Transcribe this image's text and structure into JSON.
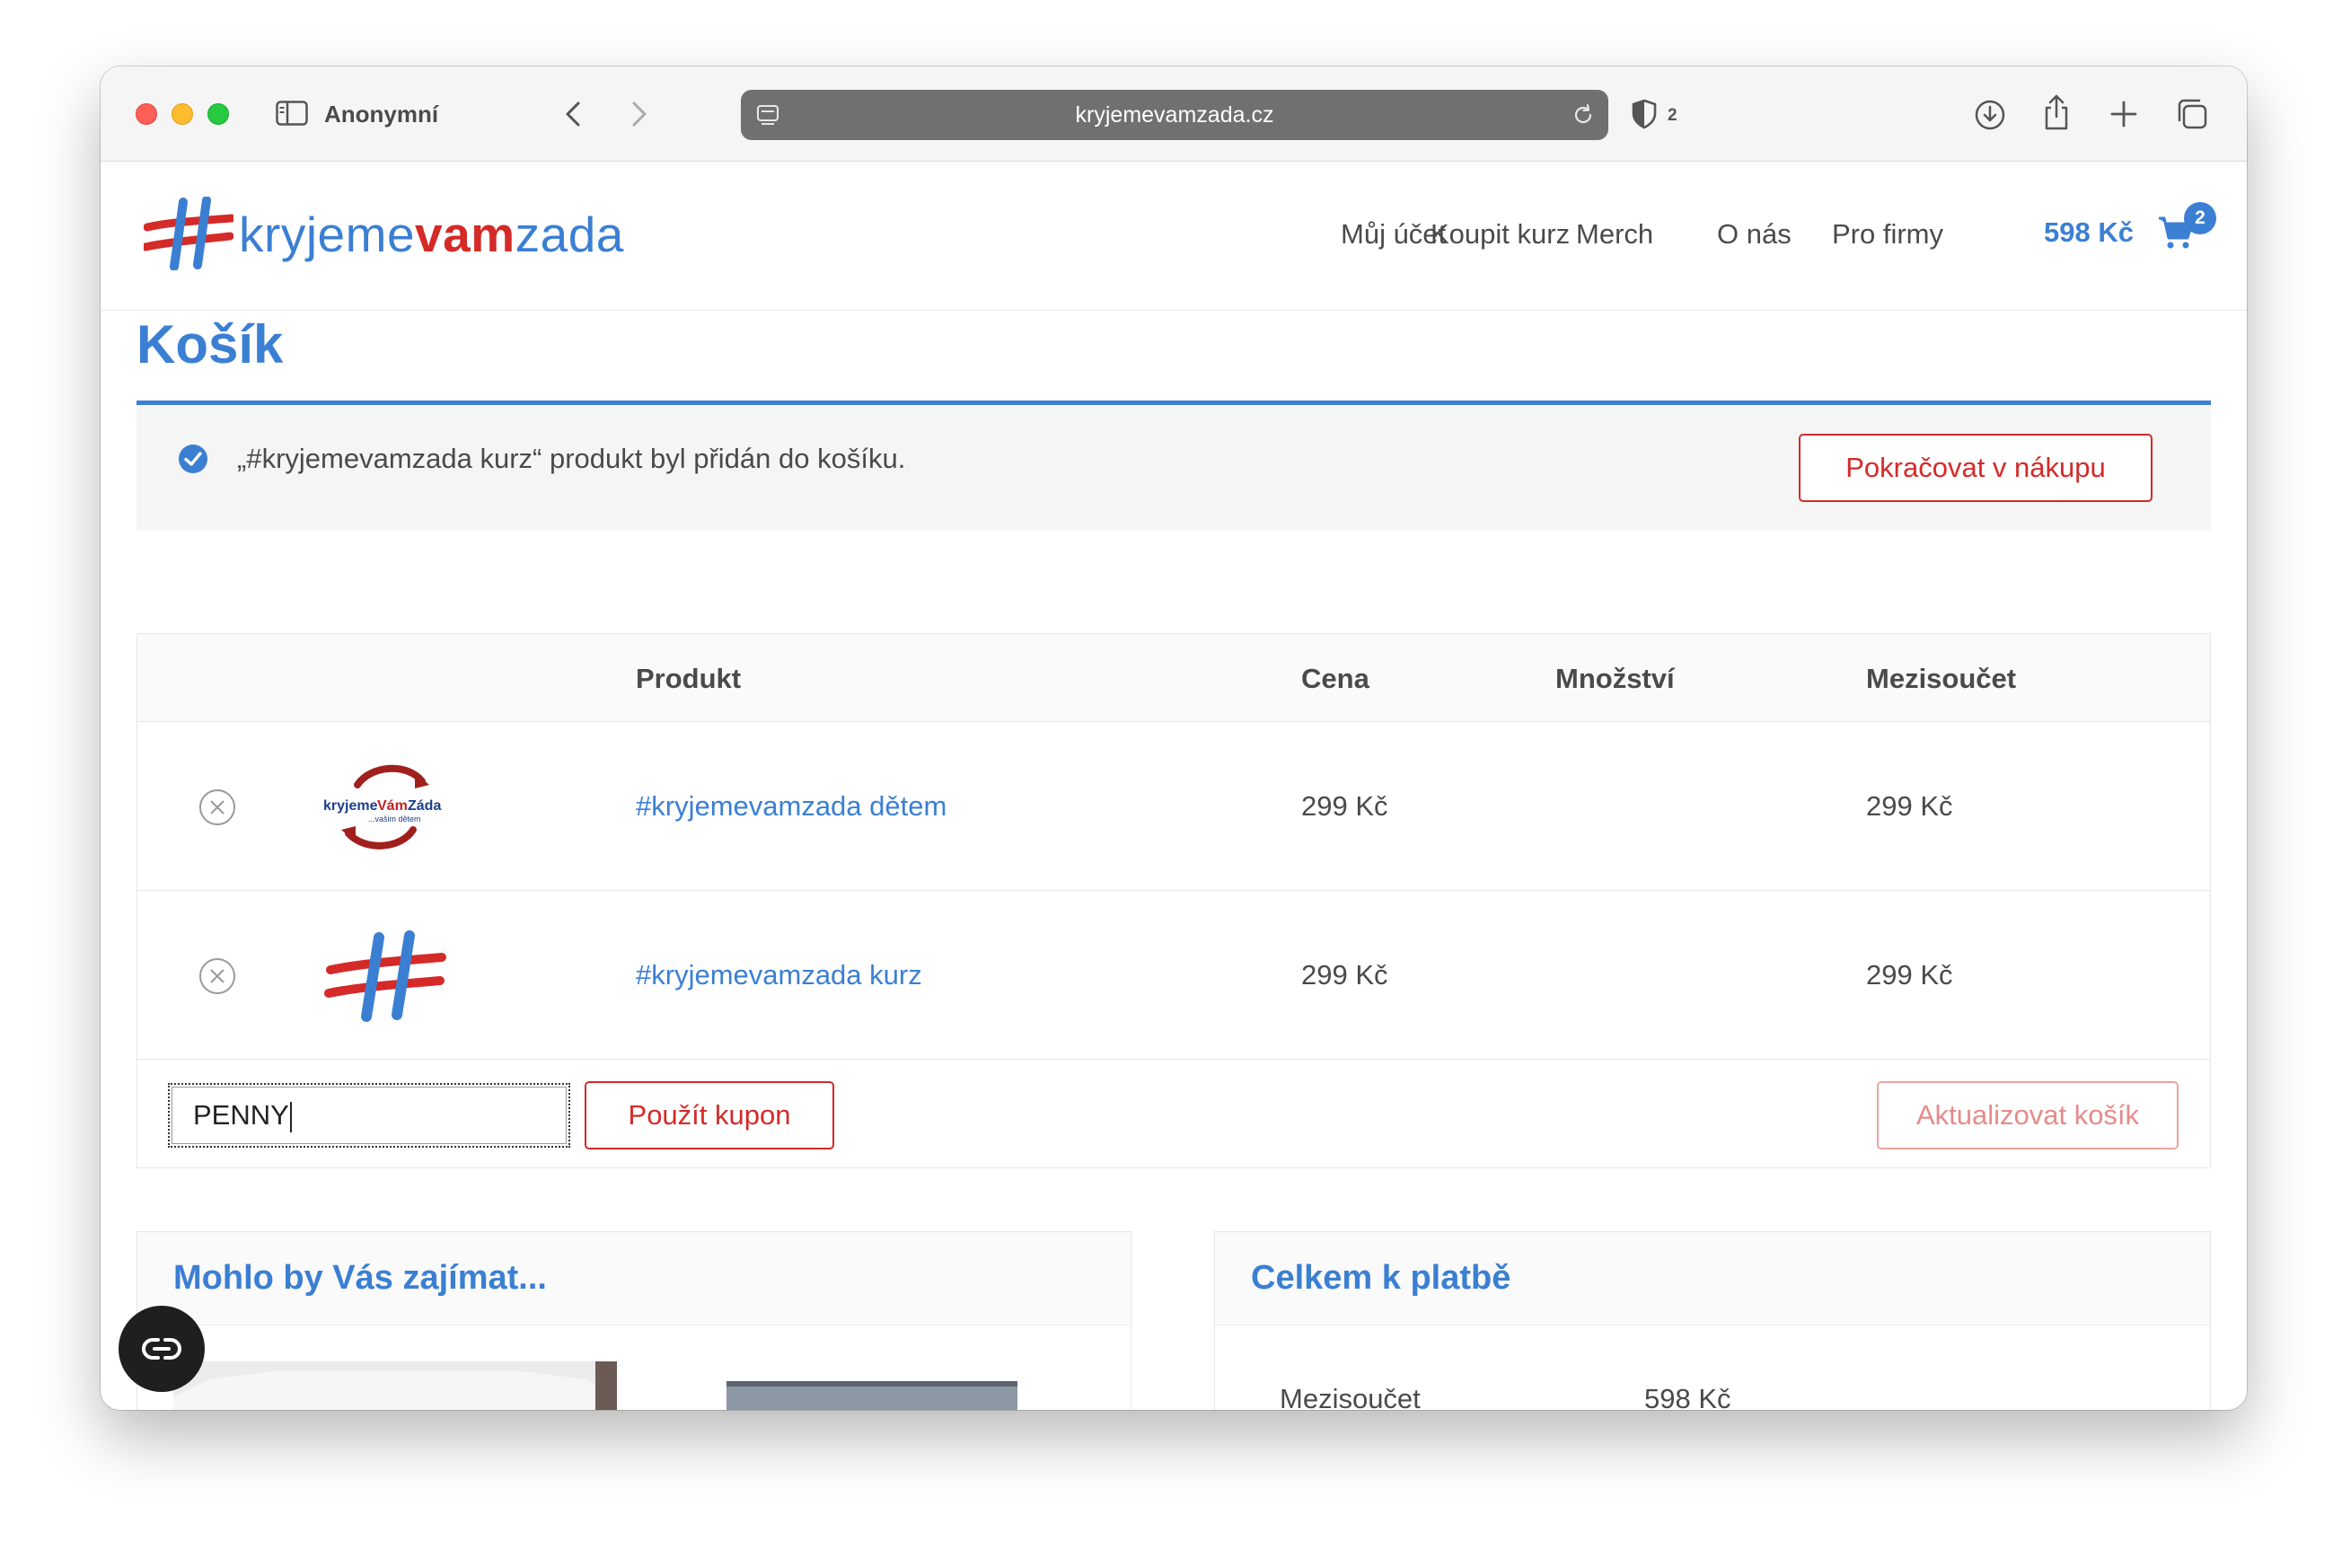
{
  "browser": {
    "profile_label": "Anonymní",
    "url": "kryjemevamzada.cz",
    "shield_count": "2"
  },
  "site": {
    "logo_part1": "kryjeme",
    "logo_part2": "vam",
    "logo_part3": "zada",
    "nav": [
      "Můj účet",
      "Koupit kurz",
      "Merch",
      "O nás",
      "Pro firmy"
    ],
    "cart_total": "598 Kč",
    "cart_count": "2"
  },
  "page": {
    "title": "Košík"
  },
  "notice": {
    "message": "„#kryjemevamzada kurz“ produkt byl přidán do košíku.",
    "button": "Pokračovat v nákupu"
  },
  "cart": {
    "headers": {
      "product": "Produkt",
      "price": "Cena",
      "quantity": "Množství",
      "subtotal": "Mezisoučet"
    },
    "items": [
      {
        "name": "#kryjemevamzada dětem",
        "price": "299 Kč",
        "subtotal": "299 Kč",
        "thumb_icon": "kryjemevamzada-detem-logo"
      },
      {
        "name": "#kryjemevamzada kurz",
        "price": "299 Kč",
        "subtotal": "299 Kč",
        "thumb_icon": "hashtag-logo"
      }
    ],
    "coupon_value": "PENNY",
    "apply_coupon": "Použít kupon",
    "update_cart": "Aktualizovat košík"
  },
  "recommend": {
    "title": "Mohlo by Vás zajímat..."
  },
  "totals": {
    "title": "Celkem k platbě",
    "subtotal_label": "Mezisoučet",
    "subtotal_value": "598 Kč"
  },
  "colors": {
    "brand_blue": "#3b7fd3",
    "brand_red": "#d42a28"
  }
}
